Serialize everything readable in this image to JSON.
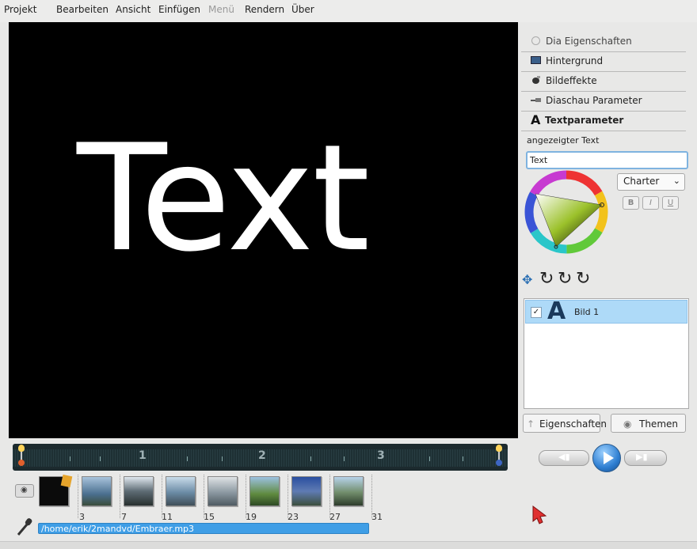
{
  "menu": [
    "Projekt",
    "Bearbeiten",
    "Ansicht",
    "Einfügen",
    "Menü",
    "Rendern",
    "Über"
  ],
  "preview": {
    "text": "Text"
  },
  "sections": [
    {
      "label": "Dia Eigenschaften",
      "icon": "slide-properties-icon"
    },
    {
      "label": "Hintergrund",
      "icon": "background-icon"
    },
    {
      "label": "Bildeffekte",
      "icon": "image-effects-icon"
    },
    {
      "label": "Diaschau Parameter",
      "icon": "slideshow-parameters-icon"
    },
    {
      "label": "Textparameter",
      "icon": "text-parameters-icon"
    }
  ],
  "text_params": {
    "label": "angezeigter Text",
    "value": "Text",
    "font": "Charter",
    "bold": "B",
    "italic": "I",
    "underline": "U"
  },
  "layers": [
    {
      "name": "Bild 1",
      "checked": true
    }
  ],
  "buttons": {
    "properties": "Eigenschaften",
    "themes": "Themen"
  },
  "timeline": {
    "marks": [
      "1",
      "2",
      "3"
    ]
  },
  "slides": [
    "3",
    "7",
    "11",
    "15",
    "19",
    "23",
    "27",
    "31"
  ],
  "audio": {
    "file": "/home/erik/2mandvd/Embraer.mp3"
  },
  "colors": {
    "accent": "#3f9ee6",
    "selection": "#aedaf8",
    "preview_bg": "#000000"
  }
}
